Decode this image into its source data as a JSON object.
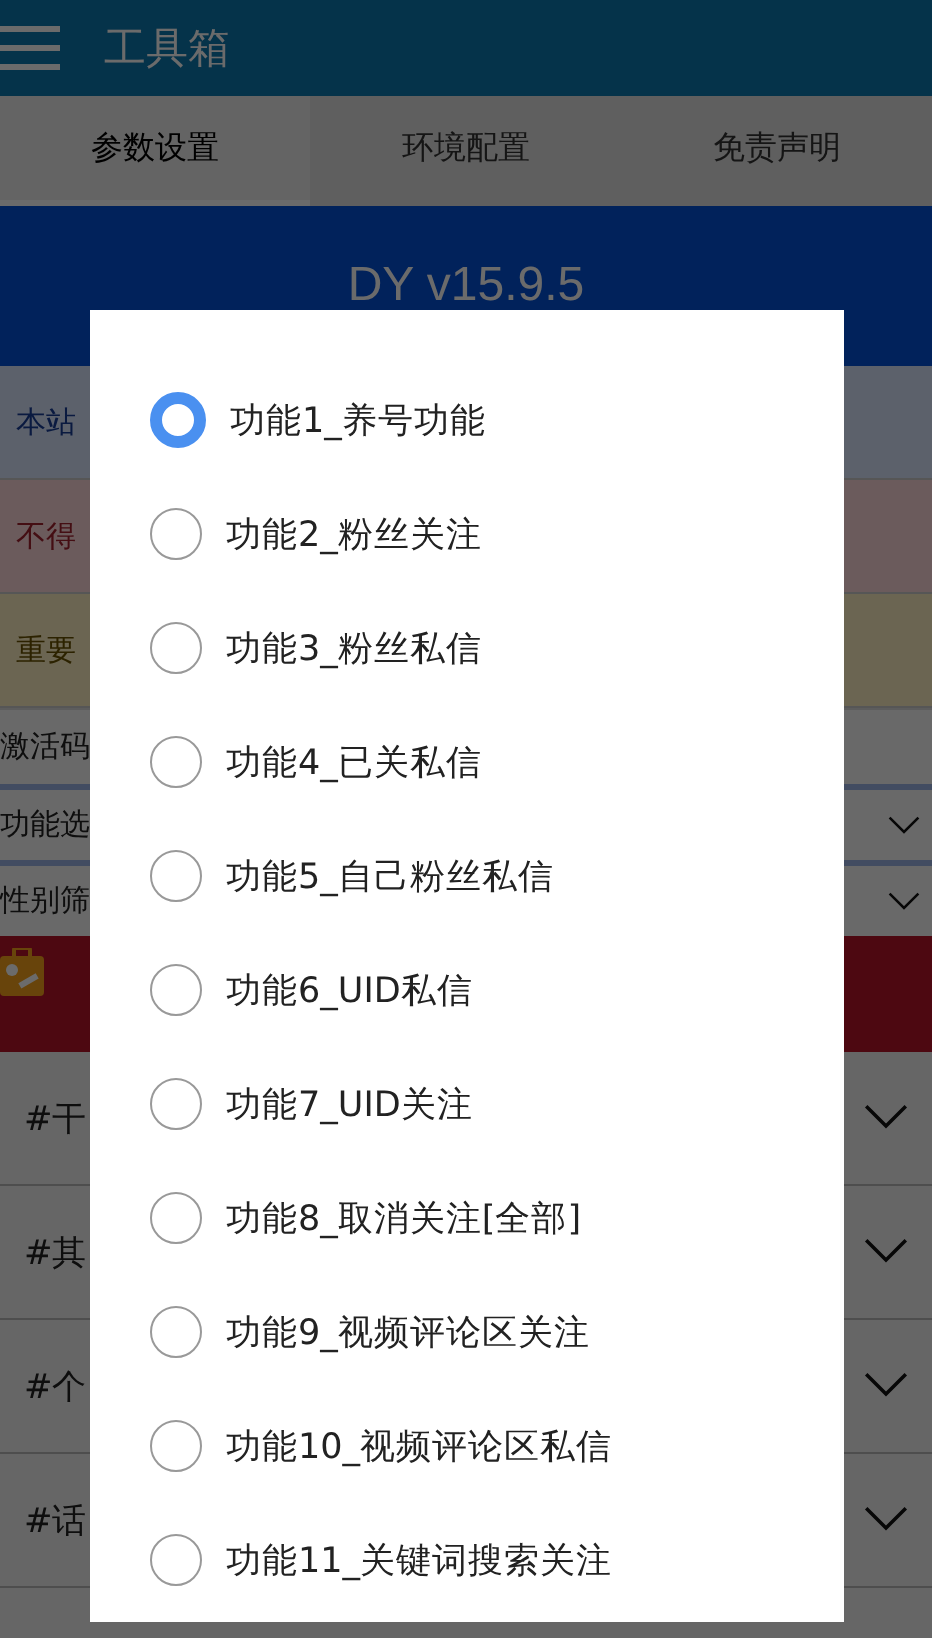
{
  "app_bar": {
    "title": "工具箱"
  },
  "tabs": [
    {
      "label": "参数设置",
      "selected": true
    },
    {
      "label": "环境配置",
      "selected": false
    },
    {
      "label": "免责声明",
      "selected": false
    }
  ],
  "banner": {
    "title": "DY v15.9.5"
  },
  "notices": [
    {
      "text": "本站",
      "kind": "info"
    },
    {
      "text": "不得",
      "kind": "danger"
    },
    {
      "text": "重要",
      "kind": "warning"
    }
  ],
  "fields": [
    {
      "label": "激活码",
      "kind": "input"
    },
    {
      "label": "功能选",
      "kind": "select"
    },
    {
      "label": "性别筛",
      "kind": "select"
    }
  ],
  "sections": [
    {
      "label": "#干"
    },
    {
      "label": "#其"
    },
    {
      "label": "#个"
    },
    {
      "label": "#话"
    }
  ],
  "dialog": {
    "options": [
      {
        "label": "功能1_养号功能",
        "selected": true
      },
      {
        "label": "功能2_粉丝关注",
        "selected": false
      },
      {
        "label": "功能3_粉丝私信",
        "selected": false
      },
      {
        "label": "功能4_已关私信",
        "selected": false
      },
      {
        "label": "功能5_自己粉丝私信",
        "selected": false
      },
      {
        "label": "功能6_UID私信",
        "selected": false
      },
      {
        "label": "功能7_UID关注",
        "selected": false
      },
      {
        "label": "功能8_取消关注[全部]",
        "selected": false
      },
      {
        "label": "功能9_视频评论区关注",
        "selected": false
      },
      {
        "label": "功能10_视频评论区私信",
        "selected": false
      },
      {
        "label": "功能11_关键词搜索关注",
        "selected": false
      }
    ]
  }
}
